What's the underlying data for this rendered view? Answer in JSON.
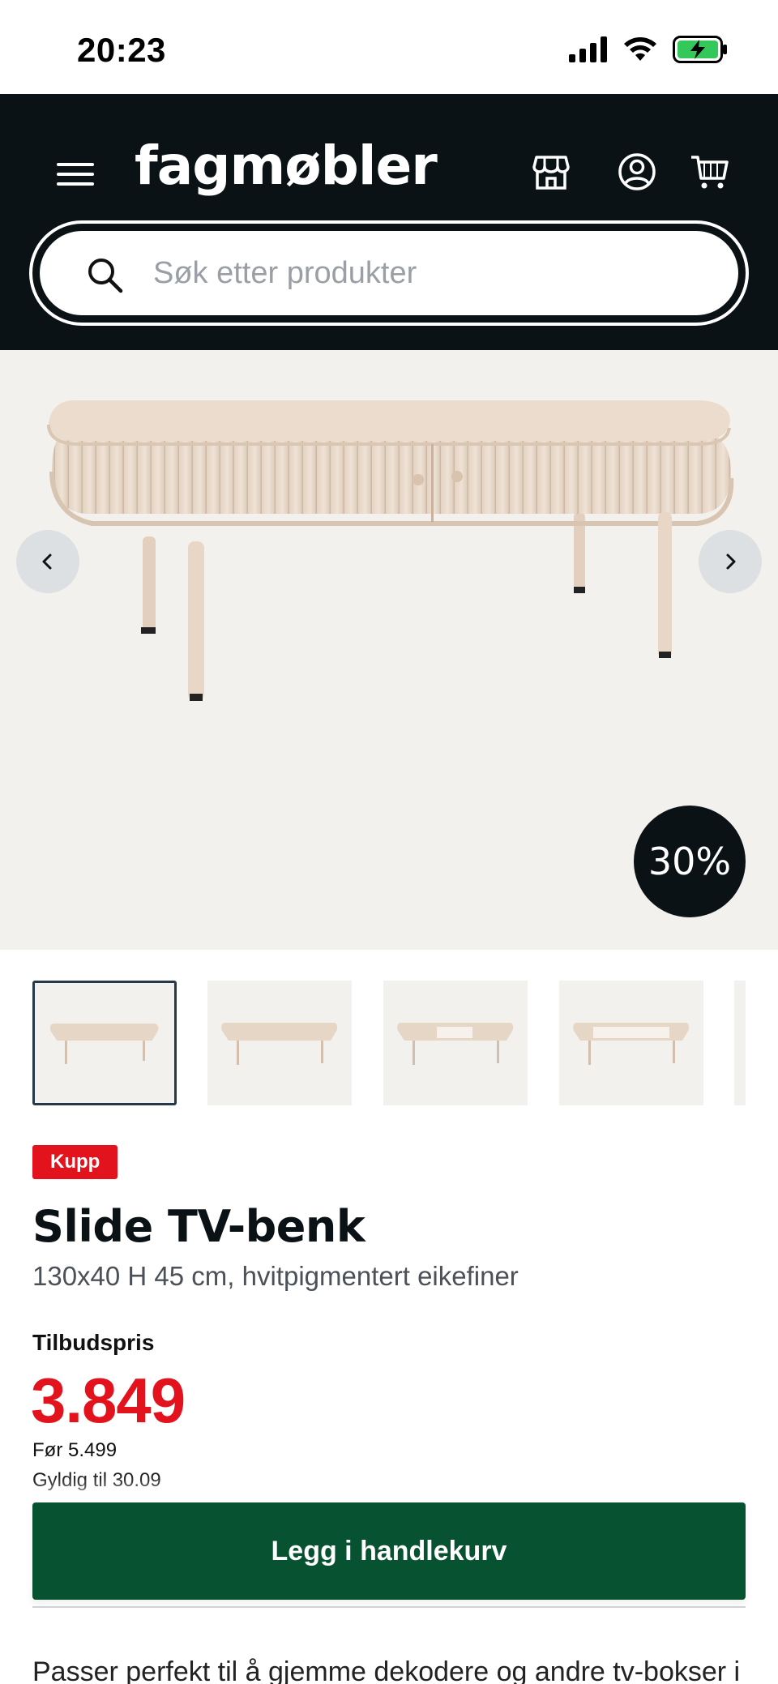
{
  "status_bar": {
    "time": "20:23",
    "icons": [
      "signal-icon",
      "wifi-icon",
      "battery-charging-icon"
    ]
  },
  "header": {
    "logo": "fagmøbler",
    "icons": [
      "menu-icon",
      "store-icon",
      "user-icon",
      "cart-icon"
    ],
    "search_placeholder": "Søk etter produkter"
  },
  "gallery": {
    "discount": "30%",
    "thumbnail_count": 5,
    "active_thumbnail": 1
  },
  "product": {
    "badge": "Kupp",
    "title": "Slide TV-benk",
    "subtitle": "130x40 H 45 cm, hvitpigmentert eikefiner",
    "price_label": "Tilbudspris",
    "price": "3.849",
    "before_price": "Før 5.499",
    "valid_until": "Gyldig til 30.09"
  },
  "actions": {
    "add_to_cart": "Legg i handlekurv"
  },
  "description": "Passer perfekt til å gjemme dekodere og andre tv-bokser i"
}
